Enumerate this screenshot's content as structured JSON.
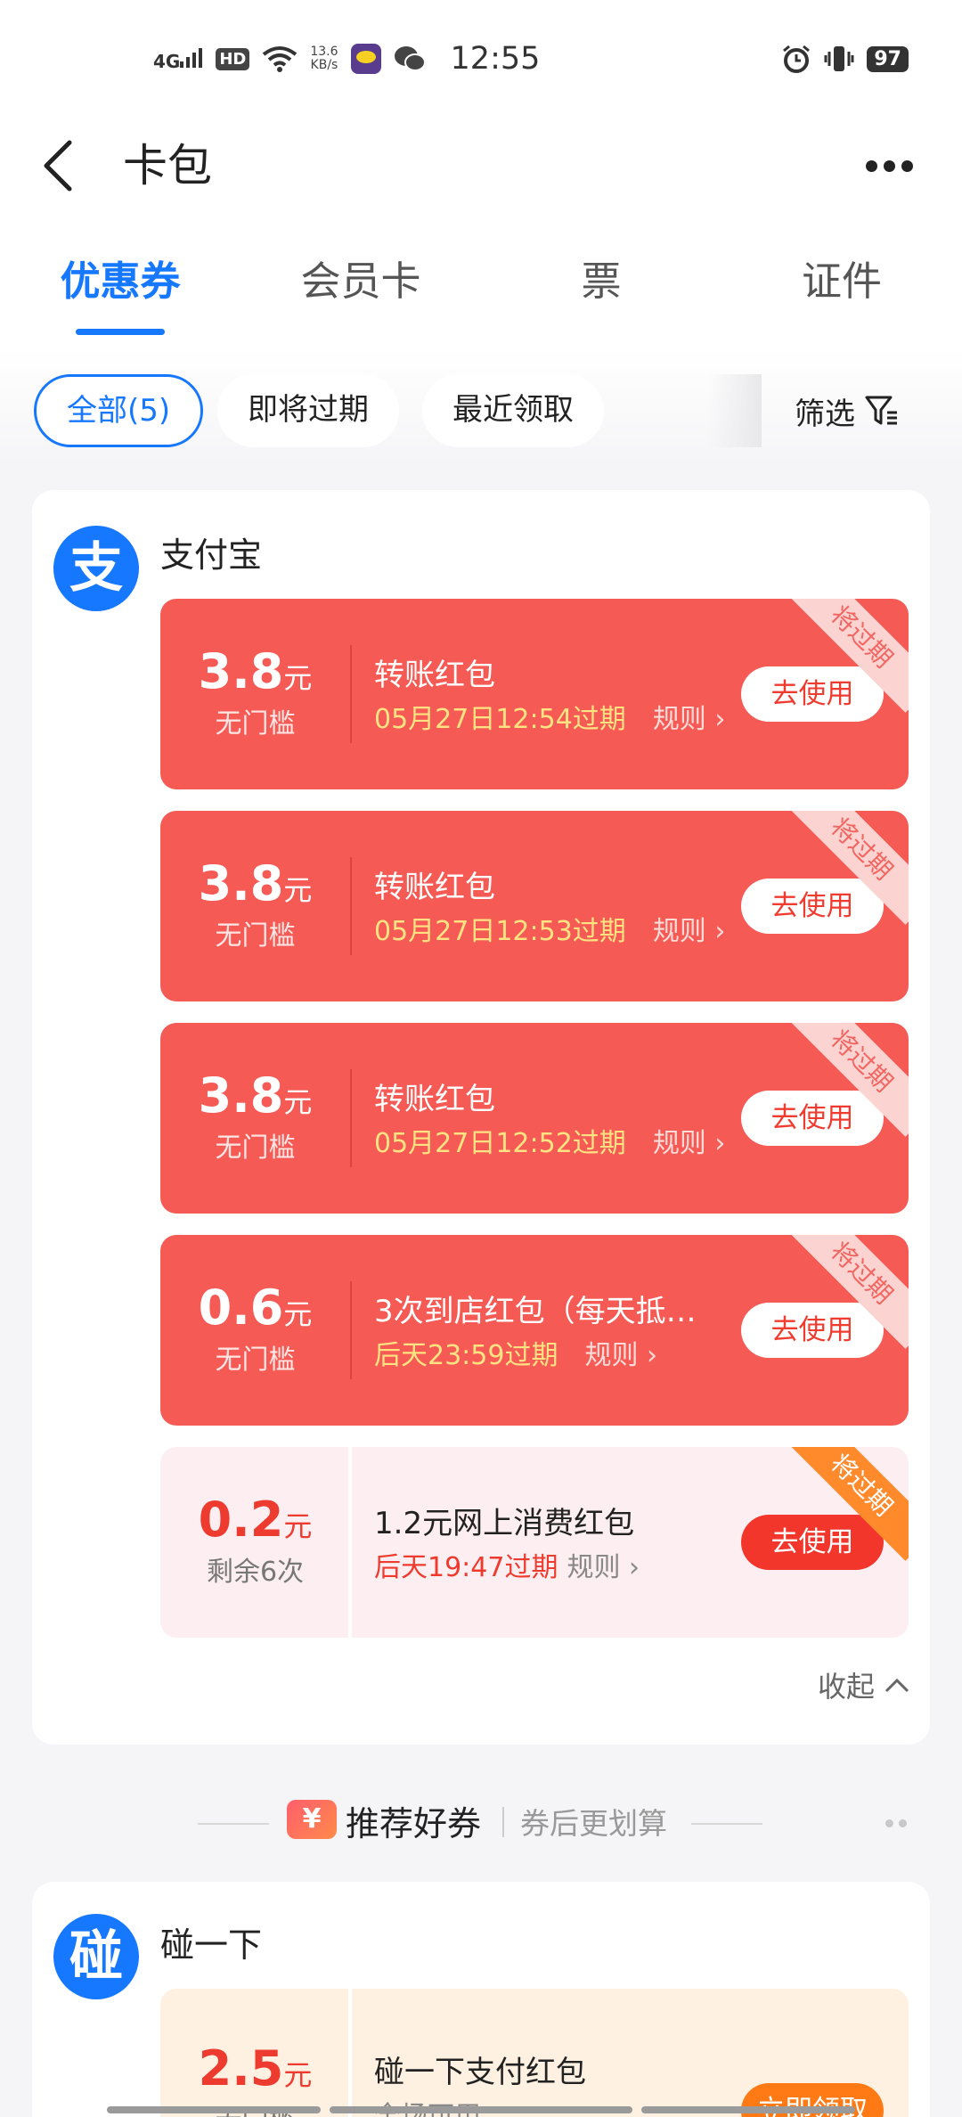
{
  "status_bar": {
    "network": "4G",
    "hd": "HD",
    "speed_value": "13.6",
    "speed_unit": "KB/s",
    "time": "12:55",
    "battery": "97"
  },
  "header": {
    "title": "卡包"
  },
  "tabs": [
    {
      "label": "优惠券",
      "active": true
    },
    {
      "label": "会员卡",
      "active": false
    },
    {
      "label": "票",
      "active": false
    },
    {
      "label": "证件",
      "active": false
    }
  ],
  "filters": {
    "chips": [
      {
        "label": "全部(5)",
        "active": true
      },
      {
        "label": "即将过期",
        "active": false
      },
      {
        "label": "最近领取",
        "active": false
      }
    ],
    "filter_label": "筛选"
  },
  "merchant": {
    "logo_char": "支",
    "name": "支付宝",
    "coupons": [
      {
        "amount": "3.8",
        "unit": "元",
        "condition": "无门槛",
        "name": "转账红包",
        "expiry": "05月27日12:54过期",
        "rule": "规则",
        "action": "去使用",
        "ribbon": "将过期",
        "style": "red"
      },
      {
        "amount": "3.8",
        "unit": "元",
        "condition": "无门槛",
        "name": "转账红包",
        "expiry": "05月27日12:53过期",
        "rule": "规则",
        "action": "去使用",
        "ribbon": "将过期",
        "style": "red"
      },
      {
        "amount": "3.8",
        "unit": "元",
        "condition": "无门槛",
        "name": "转账红包",
        "expiry": "05月27日12:52过期",
        "rule": "规则",
        "action": "去使用",
        "ribbon": "将过期",
        "style": "red"
      },
      {
        "amount": "0.6",
        "unit": "元",
        "condition": "无门槛",
        "name": "3次到店红包（每天抵…",
        "expiry": "后天23:59过期",
        "rule": "规则",
        "action": "去使用",
        "ribbon": "将过期",
        "style": "red"
      },
      {
        "amount": "0.2",
        "unit": "元",
        "condition": "剩余6次",
        "name": "1.2元网上消费红包",
        "expiry": "后天19:47过期",
        "rule": "规则",
        "action": "去使用",
        "ribbon": "将过期",
        "style": "pink"
      }
    ],
    "collapse_label": "收起"
  },
  "recommend": {
    "badge": "¥",
    "title": "推荐好券",
    "subtitle": "券后更划算"
  },
  "merchant2": {
    "logo_char": "碰",
    "name": "碰一下",
    "coupon": {
      "amount": "2.5",
      "unit": "元",
      "condition": "无门槛",
      "name": "碰一下支付红包",
      "note": "全场可用",
      "action": "立即领取"
    }
  },
  "colors": {
    "accent": "#1677ff",
    "coupon_red": "#f55a55",
    "expiry_yellow": "#ffe383",
    "ribbon_orange": "#ff8a2c",
    "claim_orange": "#ff7a14"
  }
}
